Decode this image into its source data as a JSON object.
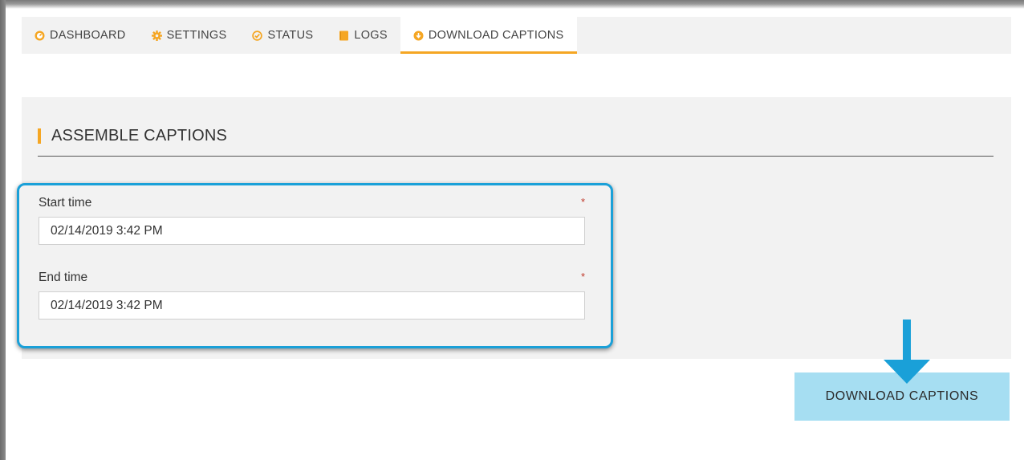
{
  "nav": {
    "tabs": [
      {
        "label": "DASHBOARD",
        "icon": "dashboard-icon"
      },
      {
        "label": "SETTINGS",
        "icon": "gear-icon"
      },
      {
        "label": "STATUS",
        "icon": "check-circle-icon"
      },
      {
        "label": "LOGS",
        "icon": "book-icon"
      },
      {
        "label": "DOWNLOAD CAPTIONS",
        "icon": "download-circle-icon",
        "active": true
      }
    ]
  },
  "section": {
    "title": "ASSEMBLE CAPTIONS"
  },
  "form": {
    "start_time": {
      "label": "Start time",
      "required_mark": "*",
      "value": "02/14/2019 3:42 PM"
    },
    "end_time": {
      "label": "End time",
      "required_mark": "*",
      "value": "02/14/2019 3:42 PM"
    }
  },
  "download_button": {
    "label": "DOWNLOAD CAPTIONS"
  },
  "colors": {
    "accent": "#f5a623",
    "highlight": "#1aa0d8",
    "button_bg": "#a6def2",
    "panel_bg": "#f2f2f2",
    "required": "#c0392b"
  }
}
